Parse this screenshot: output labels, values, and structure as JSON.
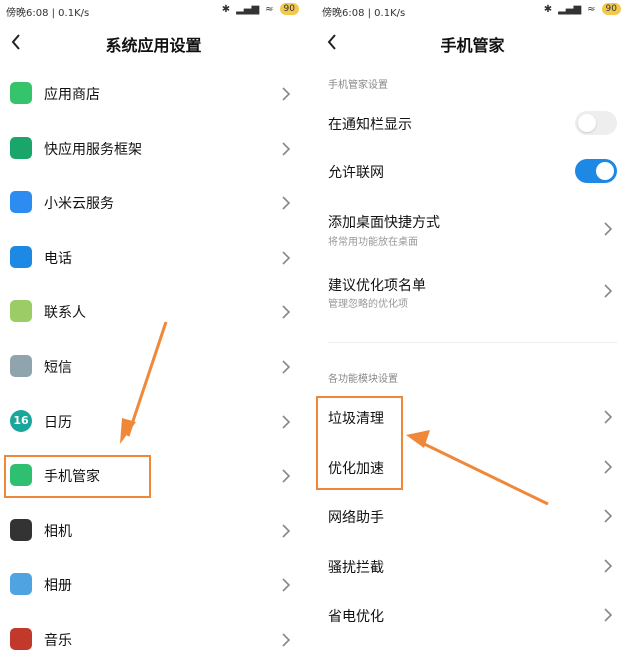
{
  "accent": "#1e88e5",
  "annotation_color": "#f0883a",
  "left": {
    "status": {
      "time": "傍晚6:08 | 0.1K/s",
      "battery": "90"
    },
    "title": "系统应用设置",
    "items": [
      {
        "label": "应用商店",
        "icon": "app-store-icon",
        "color": "#35c36b"
      },
      {
        "label": "快应用服务框架",
        "icon": "quick-app-icon",
        "color": "#1aa56b"
      },
      {
        "label": "小米云服务",
        "icon": "cloud-icon",
        "color": "#2d8cf0"
      },
      {
        "label": "电话",
        "icon": "phone-icon",
        "color": "#1e88e5"
      },
      {
        "label": "联系人",
        "icon": "contacts-icon",
        "color": "#9ccc65"
      },
      {
        "label": "短信",
        "icon": "sms-icon",
        "color": "#90a4ae"
      },
      {
        "label": "日历",
        "icon": "calendar-icon",
        "color": "#1aa69a",
        "badge": "16"
      },
      {
        "label": "手机管家",
        "icon": "security-shield-icon",
        "color": "#2fbf71"
      },
      {
        "label": "相机",
        "icon": "camera-icon",
        "color": "#333333"
      },
      {
        "label": "相册",
        "icon": "gallery-icon",
        "color": "#4fa3e0"
      },
      {
        "label": "音乐",
        "icon": "music-icon",
        "color": "#c0392b"
      }
    ]
  },
  "right": {
    "status": {
      "time": "傍晚6:08 | 0.1K/s",
      "battery": "90"
    },
    "title": "手机管家",
    "section1": "手机管家设置",
    "notif": {
      "label": "在通知栏显示",
      "enabled": false
    },
    "network": {
      "label": "允许联网",
      "enabled": true
    },
    "shortcut": {
      "label": "添加桌面快捷方式",
      "sub": "将常用功能放在桌面"
    },
    "suggest": {
      "label": "建议优化项名单",
      "sub": "管理忽略的优化项"
    },
    "section2": "各功能模块设置",
    "modules": [
      {
        "label": "垃圾清理"
      },
      {
        "label": "优化加速"
      },
      {
        "label": "网络助手"
      },
      {
        "label": "骚扰拦截"
      },
      {
        "label": "省电优化"
      }
    ]
  }
}
